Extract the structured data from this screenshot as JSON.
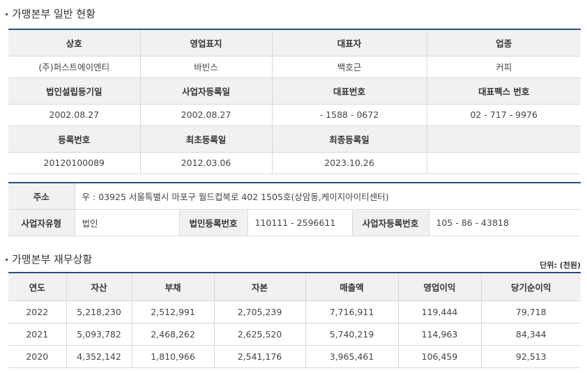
{
  "general": {
    "title": "가맹본부 일반 현황",
    "row1_headers": [
      "상호",
      "영업표지",
      "대표자",
      "업종"
    ],
    "row1_values": [
      "(주)퍼스트에이엔티",
      "바빈스",
      "백호근",
      "커피"
    ],
    "row2_headers": [
      "법인설립등기일",
      "사업자등록일",
      "대표번호",
      "대표팩스 번호"
    ],
    "row2_values": [
      "2002.08.27",
      "2002.08.27",
      "- 1588 - 0672",
      "02 - 717 - 9976"
    ],
    "row3_headers": [
      "등록번호",
      "최초등록일",
      "최종등록일",
      ""
    ],
    "row3_values": [
      "20120100089",
      "2012.03.06",
      "2023.10.26",
      ""
    ]
  },
  "address": {
    "address_label": "주소",
    "address_value": "우 : 03925 서울특별시 마포구 월드컵북로 402 1505호(상암동,케이지아이티센터)",
    "biz_type_label": "사업자유형",
    "biz_type_value": "법인",
    "corp_reg_label": "법인등록번호",
    "corp_reg_value": "110111 - 2596611",
    "biz_reg_label": "사업자등록번호",
    "biz_reg_value": "105 - 86 - 43818"
  },
  "finance": {
    "title": "가맹본부 재무상황",
    "unit": "단위: (천원)",
    "headers": [
      "연도",
      "자산",
      "부채",
      "자본",
      "매출액",
      "영업이익",
      "당기순이익"
    ],
    "rows": [
      [
        "2022",
        "5,218,230",
        "2,512,991",
        "2,705,239",
        "7,716,911",
        "119,444",
        "79,718"
      ],
      [
        "2021",
        "5,093,782",
        "2,468,262",
        "2,625,520",
        "5,740,219",
        "114,963",
        "84,344"
      ],
      [
        "2020",
        "4,352,142",
        "1,810,966",
        "2,541,176",
        "3,965,461",
        "106,459",
        "92,513"
      ]
    ]
  }
}
